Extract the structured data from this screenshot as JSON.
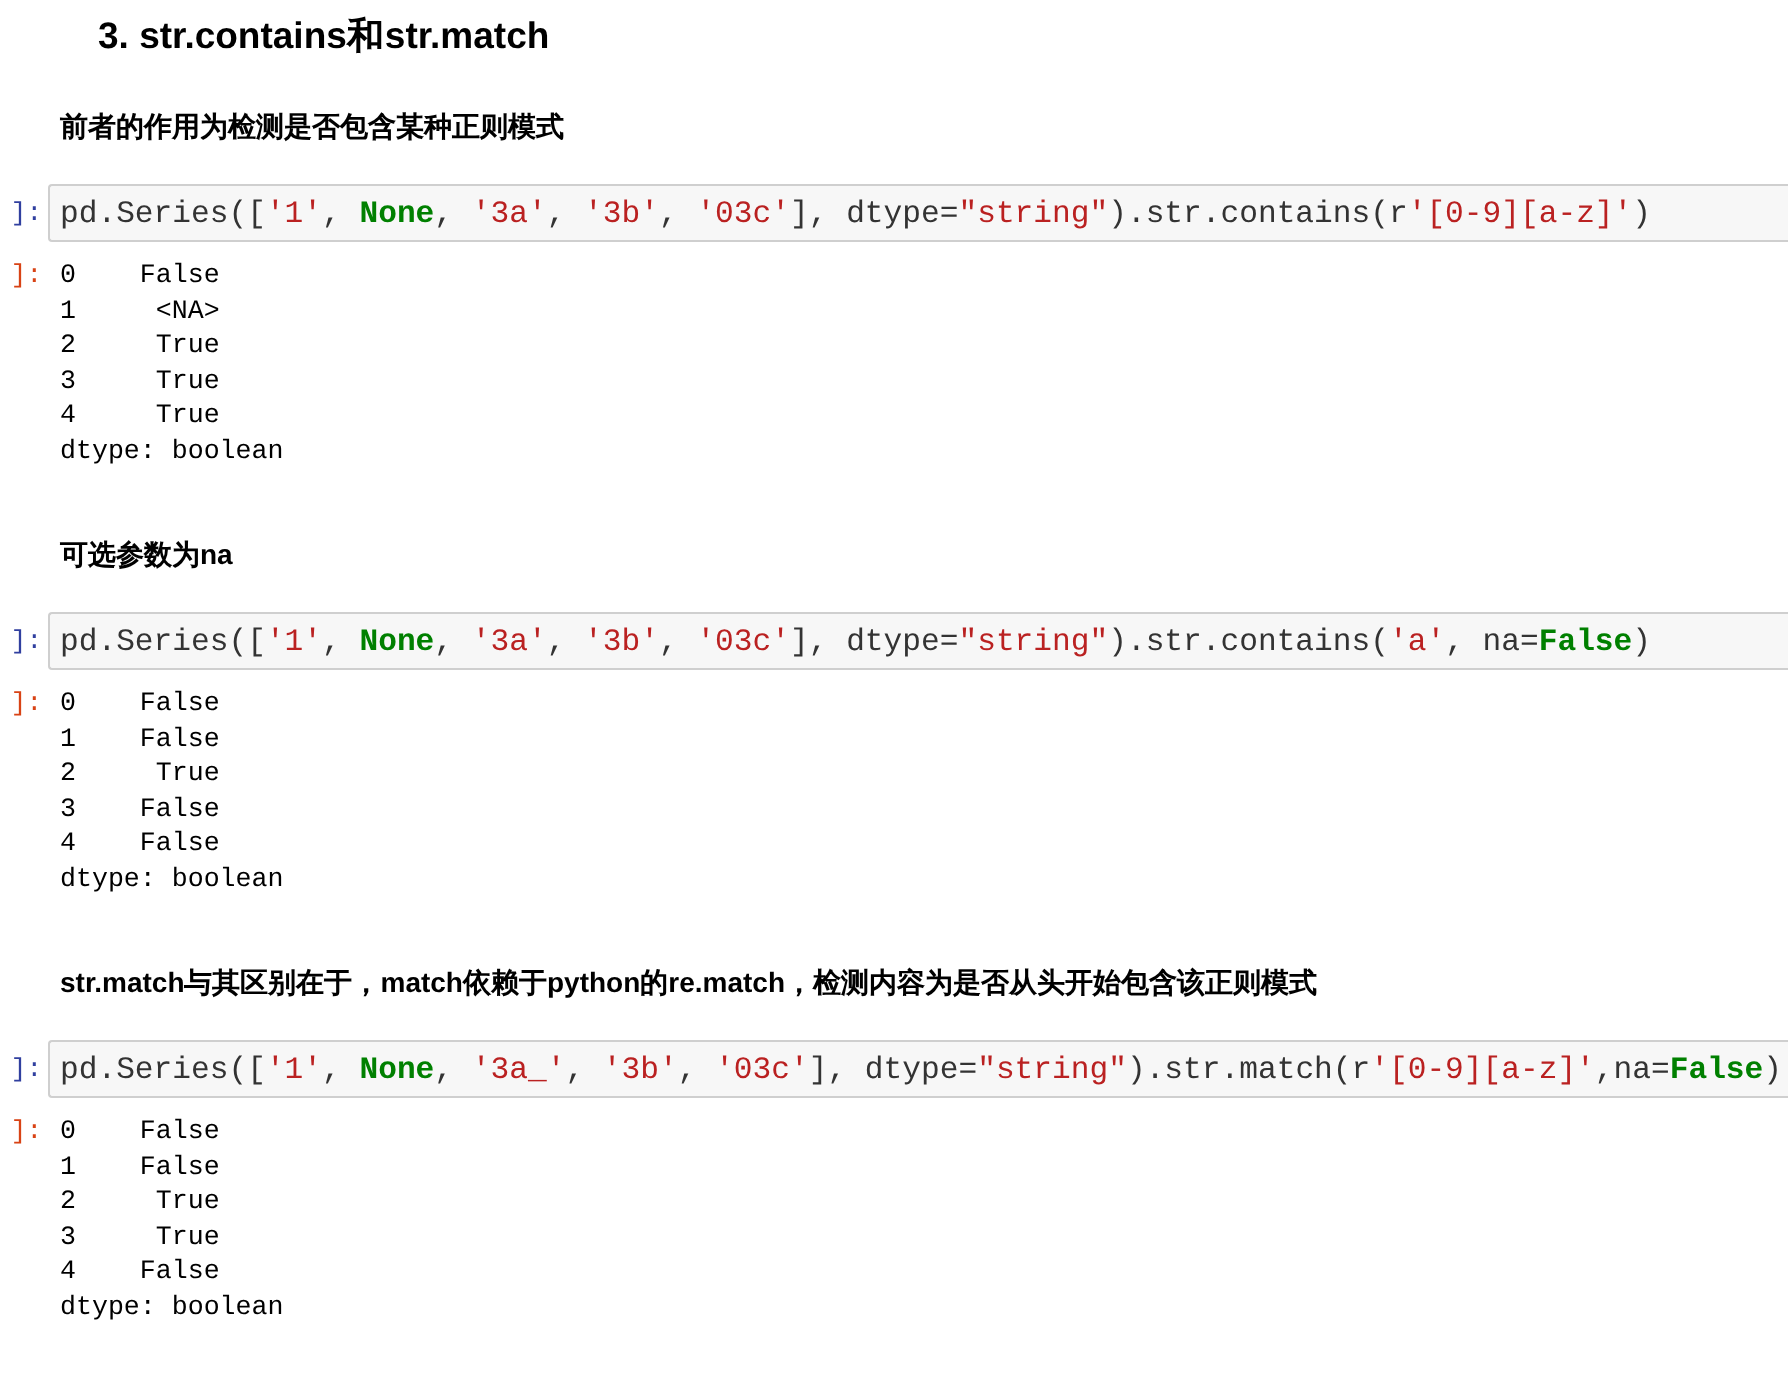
{
  "heading": "3. str.contains和str.match",
  "cells": [
    {
      "kind": "markdown",
      "text": "前者的作用为检测是否包含某种正则模式"
    },
    {
      "kind": "code",
      "prompt": "]:",
      "tokens": [
        {
          "kind": "plain",
          "text": "pd.Series(["
        },
        {
          "kind": "string",
          "text": "'1'"
        },
        {
          "kind": "plain",
          "text": ", "
        },
        {
          "kind": "keyword",
          "text": "None"
        },
        {
          "kind": "plain",
          "text": ", "
        },
        {
          "kind": "string",
          "text": "'3a'"
        },
        {
          "kind": "plain",
          "text": ", "
        },
        {
          "kind": "string",
          "text": "'3b'"
        },
        {
          "kind": "plain",
          "text": ", "
        },
        {
          "kind": "string",
          "text": "'03c'"
        },
        {
          "kind": "plain",
          "text": "], dtype="
        },
        {
          "kind": "string",
          "text": "\"string\""
        },
        {
          "kind": "plain",
          "text": ").str.contains(r"
        },
        {
          "kind": "string",
          "text": "'[0-9][a-z]'"
        },
        {
          "kind": "plain",
          "text": ")"
        }
      ],
      "output_prompt": "]:",
      "output": [
        "0    False",
        "1     <NA>",
        "2     True",
        "3     True",
        "4     True",
        "dtype: boolean"
      ]
    },
    {
      "kind": "markdown",
      "text": "可选参数为na"
    },
    {
      "kind": "code",
      "prompt": "]:",
      "tokens": [
        {
          "kind": "plain",
          "text": "pd.Series(["
        },
        {
          "kind": "string",
          "text": "'1'"
        },
        {
          "kind": "plain",
          "text": ", "
        },
        {
          "kind": "keyword",
          "text": "None"
        },
        {
          "kind": "plain",
          "text": ", "
        },
        {
          "kind": "string",
          "text": "'3a'"
        },
        {
          "kind": "plain",
          "text": ", "
        },
        {
          "kind": "string",
          "text": "'3b'"
        },
        {
          "kind": "plain",
          "text": ", "
        },
        {
          "kind": "string",
          "text": "'03c'"
        },
        {
          "kind": "plain",
          "text": "], dtype="
        },
        {
          "kind": "string",
          "text": "\"string\""
        },
        {
          "kind": "plain",
          "text": ").str.contains("
        },
        {
          "kind": "string",
          "text": "'a'"
        },
        {
          "kind": "plain",
          "text": ", na="
        },
        {
          "kind": "keyword",
          "text": "False"
        },
        {
          "kind": "plain",
          "text": ")"
        }
      ],
      "output_prompt": "]:",
      "output": [
        "0    False",
        "1    False",
        "2     True",
        "3    False",
        "4    False",
        "dtype: boolean"
      ]
    },
    {
      "kind": "markdown",
      "text": "str.match与其区别在于，match依赖于python的re.match，检测内容为是否从头开始包含该正则模式"
    },
    {
      "kind": "code",
      "prompt": "]:",
      "tokens": [
        {
          "kind": "plain",
          "text": "pd.Series(["
        },
        {
          "kind": "string",
          "text": "'1'"
        },
        {
          "kind": "plain",
          "text": ", "
        },
        {
          "kind": "keyword",
          "text": "None"
        },
        {
          "kind": "plain",
          "text": ", "
        },
        {
          "kind": "string",
          "text": "'3a_'"
        },
        {
          "kind": "plain",
          "text": ", "
        },
        {
          "kind": "string",
          "text": "'3b'"
        },
        {
          "kind": "plain",
          "text": ", "
        },
        {
          "kind": "string",
          "text": "'03c'"
        },
        {
          "kind": "plain",
          "text": "], dtype="
        },
        {
          "kind": "string",
          "text": "\"string\""
        },
        {
          "kind": "plain",
          "text": ").str.match(r"
        },
        {
          "kind": "string",
          "text": "'[0-9][a-z]'"
        },
        {
          "kind": "plain",
          "text": ",na="
        },
        {
          "kind": "keyword",
          "text": "False"
        },
        {
          "kind": "plain",
          "text": ")"
        }
      ],
      "output_prompt": "]:",
      "output": [
        "0    False",
        "1    False",
        "2     True",
        "3     True",
        "4    False",
        "dtype: boolean"
      ]
    }
  ]
}
